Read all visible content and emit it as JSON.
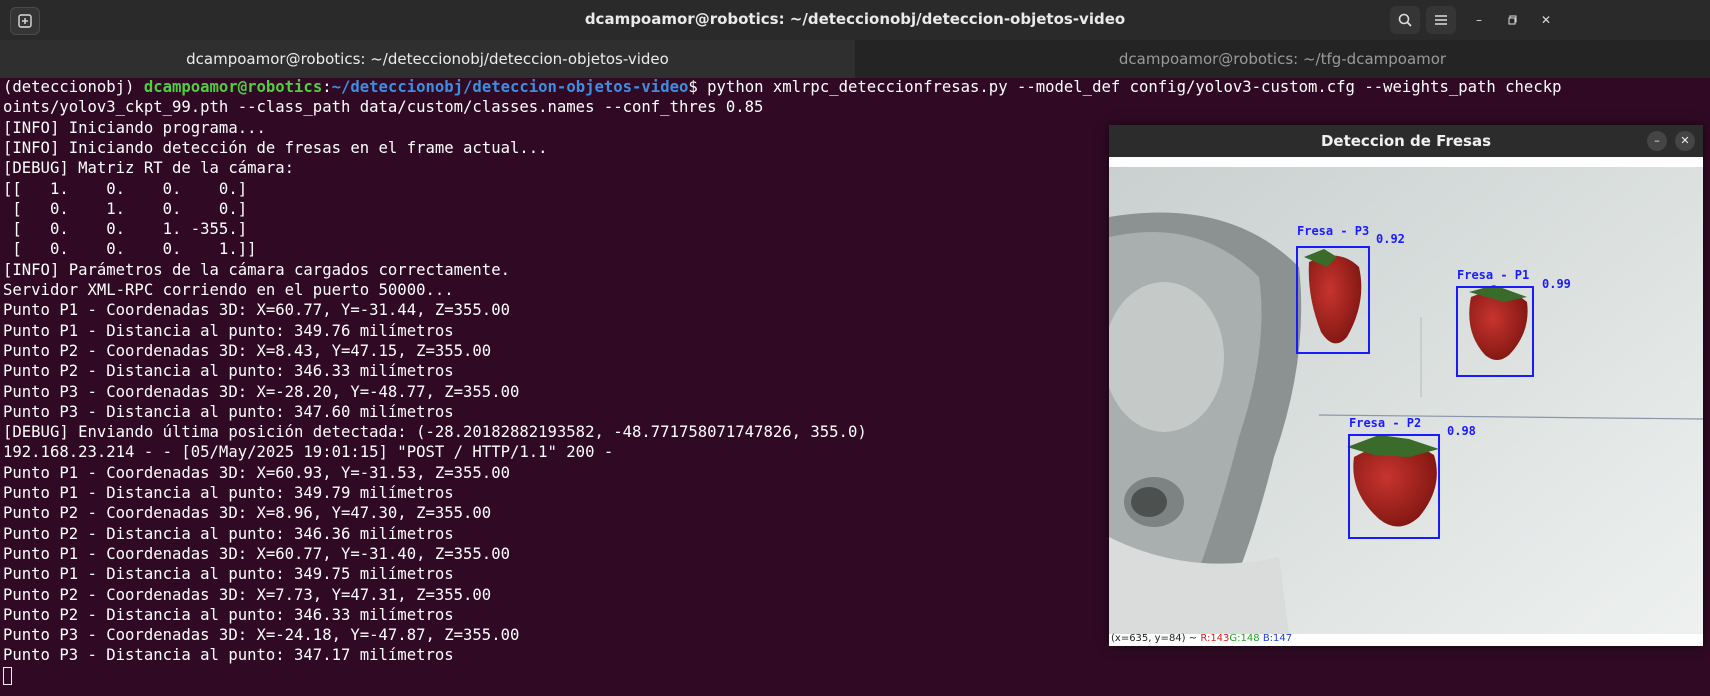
{
  "window": {
    "title": "dcampoamor@robotics: ~/deteccionobj/deteccion-objetos-video"
  },
  "tabs": [
    {
      "label": "dcampoamor@robotics: ~/deteccionobj/deteccion-objetos-video"
    },
    {
      "label": "dcampoamor@robotics: ~/tfg-dcampoamor"
    }
  ],
  "terminal": {
    "prompt": {
      "env": "(deteccionobj) ",
      "user": "dcampoamor@robotics",
      "sep": ":",
      "path": "~/deteccionobj/deteccion-objetos-video",
      "symbol": "$ ",
      "command1": "python xmlrpc_deteccionfresas.py --model_def config/yolov3-custom.cfg --weights_path checkp",
      "command2": "oints/yolov3_ckpt_99.pth --class_path data/custom/classes.names --conf_thres 0.85"
    },
    "lines": [
      "[INFO] Iniciando programa...",
      "[INFO] Iniciando detección de fresas en el frame actual...",
      "[DEBUG] Matriz RT de la cámara:",
      "[[   1.    0.    0.    0.]",
      " [   0.    1.    0.    0.]",
      " [   0.    0.    1. -355.]",
      " [   0.    0.    0.    1.]]",
      "[INFO] Parámetros de la cámara cargados correctamente.",
      "Servidor XML-RPC corriendo en el puerto 50000...",
      "Punto P1 - Coordenadas 3D: X=60.77, Y=-31.44, Z=355.00",
      "Punto P1 - Distancia al punto: 349.76 milímetros",
      "Punto P2 - Coordenadas 3D: X=8.43, Y=47.15, Z=355.00",
      "Punto P2 - Distancia al punto: 346.33 milímetros",
      "Punto P3 - Coordenadas 3D: X=-28.20, Y=-48.77, Z=355.00",
      "Punto P3 - Distancia al punto: 347.60 milímetros",
      "[DEBUG] Enviando última posición detectada: (-28.2018288219358­2, -48.771758071747826, 355.0)",
      "192.168.23.214 - - [05/May/2025 19:01:15] \"POST / HTTP/1.1\" 200 -",
      "Punto P1 - Coordenadas 3D: X=60.93, Y=-31.53, Z=355.00",
      "Punto P1 - Distancia al punto: 349.79 milímetros",
      "Punto P2 - Coordenadas 3D: X=8.96, Y=47.30, Z=355.00",
      "Punto P2 - Distancia al punto: 346.36 milímetros",
      "Punto P1 - Coordenadas 3D: X=60.77, Y=-31.40, Z=355.00",
      "Punto P1 - Distancia al punto: 349.75 milímetros",
      "Punto P2 - Coordenadas 3D: X=7.73, Y=47.31, Z=355.00",
      "Punto P2 - Distancia al punto: 346.33 milímetros",
      "Punto P3 - Coordenadas 3D: X=-24.18, Y=-47.87, Z=355.00",
      "Punto P3 - Distancia al punto: 347.17 milímetros"
    ]
  },
  "popup": {
    "title": "Deteccion de Fresas",
    "detections": [
      {
        "label": "Fresa - P3",
        "score": "0.92"
      },
      {
        "label": "Fresa - P1",
        "score": "0.99"
      },
      {
        "label": "Fresa - P2",
        "score": "0.98"
      }
    ],
    "status": {
      "coords": "(x=635, y=84) ~",
      "r": "R:143",
      "g": "G:148",
      "b": "B:147"
    }
  },
  "icons": [
    "new-tab-icon",
    "search-icon",
    "hamburger-menu-icon",
    "minimize-icon",
    "maximize-icon",
    "close-icon"
  ],
  "colors": {
    "terminal_bg": "#300a24",
    "prompt_user": "#4fcf3c",
    "prompt_path": "#3e8ee0",
    "bbox": "#1a1aff"
  }
}
